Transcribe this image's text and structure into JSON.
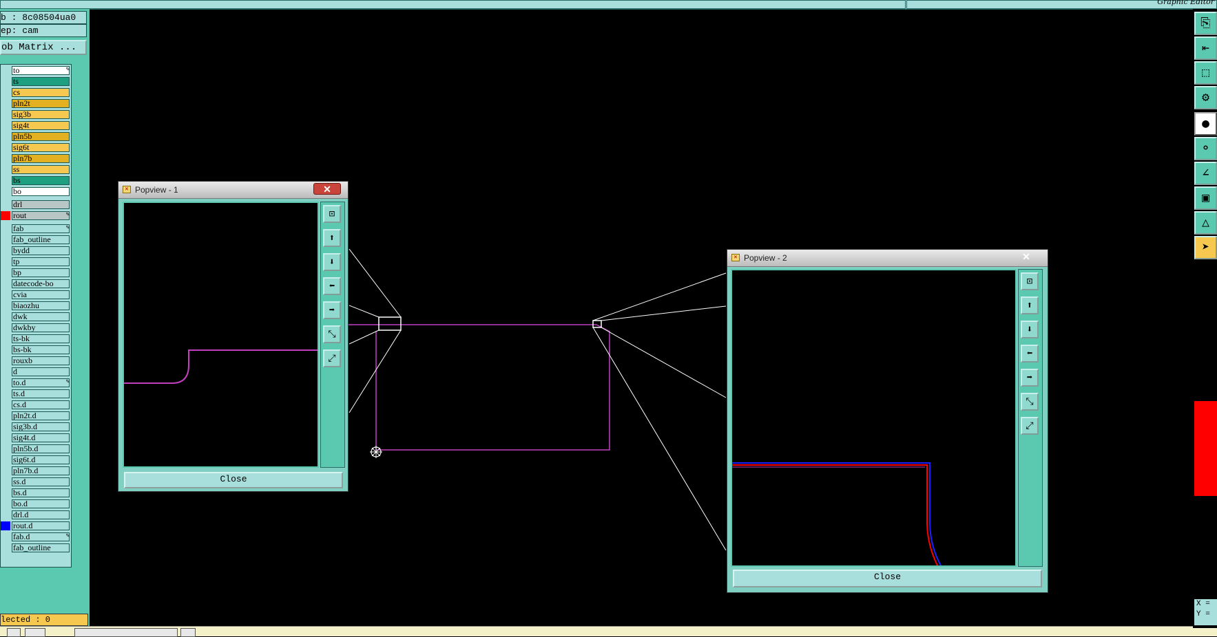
{
  "app": {
    "title": "Graphic Editor"
  },
  "job_info": {
    "job": "b : 8c08504ua0",
    "step": "ep: cam",
    "matrix_button": "ob Matrix ..."
  },
  "layers": [
    {
      "name": "to",
      "color": "#ffffff",
      "edit": true
    },
    {
      "name": "ts",
      "color": "#1e9f80"
    },
    {
      "name": "cs",
      "color": "#f6c84f"
    },
    {
      "name": "pln2t",
      "color": "#e2b020"
    },
    {
      "name": "sig3b",
      "color": "#f6c84f"
    },
    {
      "name": "sig4t",
      "color": "#f6c84f"
    },
    {
      "name": "pln5b",
      "color": "#e2b020"
    },
    {
      "name": "sig6t",
      "color": "#f6c84f"
    },
    {
      "name": "pln7b",
      "color": "#e2b020"
    },
    {
      "name": "ss",
      "color": "#f6c84f"
    },
    {
      "name": "bs",
      "color": "#1e9f80"
    },
    {
      "name": "bo",
      "color": "#ffffff"
    },
    {
      "name": "drl",
      "color": "#b8c7c5"
    },
    {
      "name": "rout",
      "color": "#b8c7c5",
      "swatch": "#ff0000",
      "edit": true
    },
    {
      "name": "fab",
      "color": "#a8dedb",
      "edit": true
    },
    {
      "name": "fab_outline",
      "color": "#a8dedb"
    },
    {
      "name": "bydd",
      "color": "#a8dedb"
    },
    {
      "name": "tp",
      "color": "#a8dedb"
    },
    {
      "name": "bp",
      "color": "#a8dedb"
    },
    {
      "name": "datecode-bo",
      "color": "#a8dedb"
    },
    {
      "name": "cvia",
      "color": "#a8dedb"
    },
    {
      "name": "biaozhu",
      "color": "#a8dedb"
    },
    {
      "name": "dwk",
      "color": "#a8dedb"
    },
    {
      "name": "dwkby",
      "color": "#a8dedb"
    },
    {
      "name": "ts-bk",
      "color": "#a8dedb"
    },
    {
      "name": "bs-bk",
      "color": "#a8dedb"
    },
    {
      "name": "rouxb",
      "color": "#a8dedb"
    },
    {
      "name": "d",
      "color": "#a8dedb"
    },
    {
      "name": "to.d",
      "color": "#a8dedb",
      "edit": true
    },
    {
      "name": "ts.d",
      "color": "#a8dedb"
    },
    {
      "name": "cs.d",
      "color": "#a8dedb"
    },
    {
      "name": "pln2t.d",
      "color": "#a8dedb"
    },
    {
      "name": "sig3b.d",
      "color": "#a8dedb"
    },
    {
      "name": "sig4t.d",
      "color": "#a8dedb"
    },
    {
      "name": "pln5b.d",
      "color": "#a8dedb"
    },
    {
      "name": "sig6t.d",
      "color": "#a8dedb"
    },
    {
      "name": "pln7b.d",
      "color": "#a8dedb"
    },
    {
      "name": "ss.d",
      "color": "#a8dedb"
    },
    {
      "name": "bs.d",
      "color": "#a8dedb"
    },
    {
      "name": "bo.d",
      "color": "#a8dedb"
    },
    {
      "name": "drl.d",
      "color": "#a8dedb"
    },
    {
      "name": "rout.d",
      "color": "#a8dedb",
      "swatch": "#0000ff"
    },
    {
      "name": "fab.d",
      "color": "#a8dedb",
      "edit": true
    },
    {
      "name": "fab_outline",
      "color": "#a8dedb"
    }
  ],
  "status": {
    "selected": "lected : 0"
  },
  "coords": {
    "x": "X =",
    "y": "Y ="
  },
  "popview1": {
    "title": "Popview - 1",
    "close_x": "✕",
    "close_label": "Close"
  },
  "popview2": {
    "title": "Popview - 2",
    "close_x": "✕",
    "close_label": "Close"
  },
  "colors": {
    "panel": "#5bc9b0",
    "light_panel": "#a8dedb",
    "trace": "#c040c0",
    "red_trace": "#ff0000",
    "blue_trace": "#2020ff"
  }
}
